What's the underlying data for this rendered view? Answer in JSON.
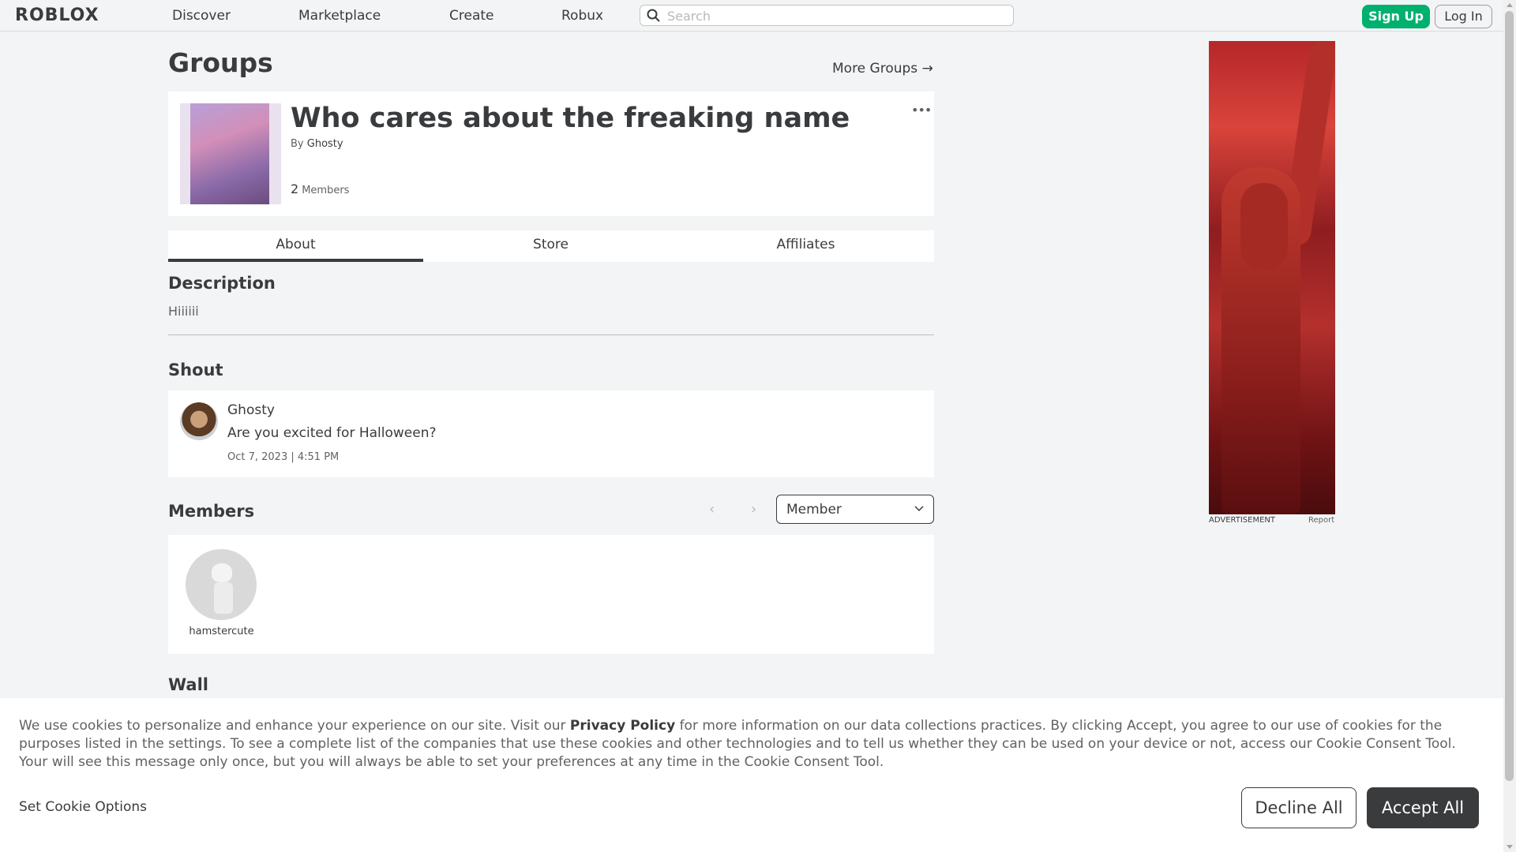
{
  "nav": {
    "logo": "ROBLOX",
    "links": [
      "Discover",
      "Marketplace",
      "Create",
      "Robux"
    ],
    "search_placeholder": "Search",
    "signup": "Sign Up",
    "login": "Log In"
  },
  "page": {
    "title": "Groups",
    "more_groups": "More Groups →"
  },
  "group": {
    "name": "Who cares about the freaking name",
    "by_prefix": "By",
    "owner": "Ghosty",
    "member_count": "2",
    "member_label": "Members",
    "more_icon": "•••"
  },
  "tabs": [
    "About",
    "Store",
    "Affiliates"
  ],
  "description": {
    "title": "Description",
    "text": "Hiiiiii"
  },
  "shout": {
    "title": "Shout",
    "user": "Ghosty",
    "message": "Are you excited for Halloween?",
    "time": "Oct 7, 2023 | 4:51 PM"
  },
  "members": {
    "title": "Members",
    "role_selected": "Member",
    "list": [
      {
        "name": "hamstercute"
      }
    ]
  },
  "wall": {
    "title": "Wall"
  },
  "ad": {
    "label": "ADVERTISEMENT",
    "report": "Report"
  },
  "cookie": {
    "text_before": "We use cookies to personalize and enhance your experience on our site. Visit our ",
    "privacy_link": "Privacy Policy",
    "text_after": " for more information on our data collections practices. By clicking Accept, you agree to our use of cookies for the purposes listed in the settings. To see a complete list of the companies that use these cookies and other technologies and to tell us whether they can be used on your device or not, access our Cookie Consent Tool. Your will see this message only once, but you will always be able to set your preferences at any time in the Cookie Consent Tool.",
    "set_options": "Set Cookie Options",
    "decline": "Decline All",
    "accept": "Accept All"
  },
  "colors": {
    "signup": "#00b06f",
    "accept_bg": "#393b3d",
    "background": "#f2f4f5"
  }
}
